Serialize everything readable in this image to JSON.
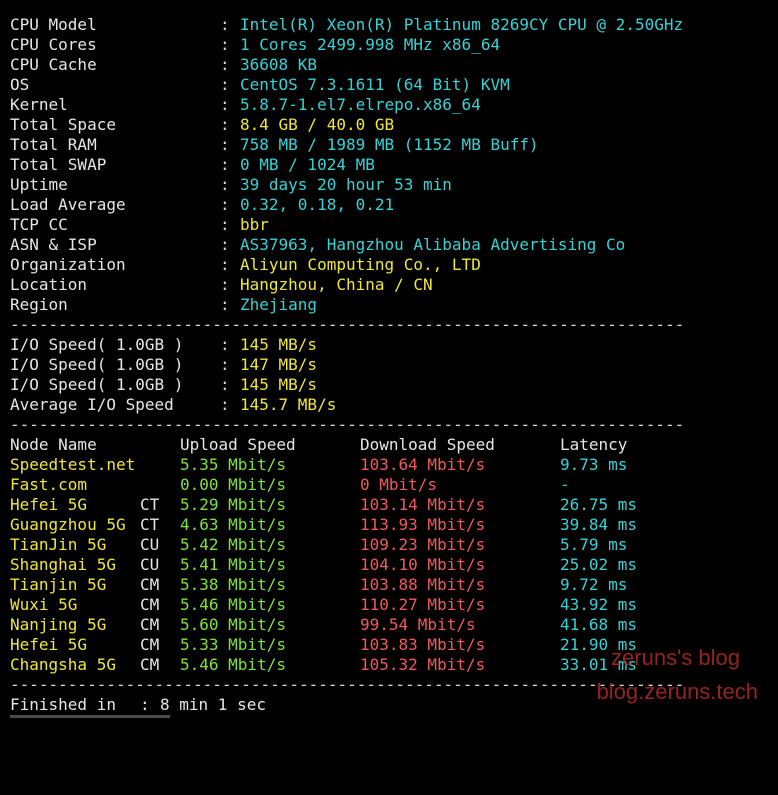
{
  "sysinfo": [
    {
      "label": "CPU Model",
      "value": "Intel(R) Xeon(R) Platinum 8269CY CPU @ 2.50GHz",
      "color": "cyan"
    },
    {
      "label": "CPU Cores",
      "value": "1 Cores 2499.998 MHz x86_64",
      "color": "cyan"
    },
    {
      "label": "CPU Cache",
      "value": "36608 KB",
      "color": "cyan"
    },
    {
      "label": "OS",
      "value": "CentOS 7.3.1611 (64 Bit) KVM",
      "color": "cyan"
    },
    {
      "label": "Kernel",
      "value": "5.8.7-1.el7.elrepo.x86_64",
      "color": "cyan"
    },
    {
      "label": "Total Space",
      "value": "8.4 GB / 40.0 GB",
      "color": "yellow"
    },
    {
      "label": "Total RAM",
      "value": "758 MB / 1989 MB (1152 MB Buff)",
      "color": "cyan"
    },
    {
      "label": "Total SWAP",
      "value": "0 MB / 1024 MB",
      "color": "cyan"
    },
    {
      "label": "Uptime",
      "value": "39 days 20 hour 53 min",
      "color": "cyan"
    },
    {
      "label": "Load Average",
      "value": "0.32, 0.18, 0.21",
      "color": "cyan"
    },
    {
      "label": "TCP CC",
      "value": "bbr",
      "color": "yellow"
    },
    {
      "label": "ASN & ISP",
      "value": "AS37963, Hangzhou Alibaba Advertising Co",
      "color": "cyan"
    },
    {
      "label": "Organization",
      "value": "Aliyun Computing Co., LTD",
      "color": "yellow"
    },
    {
      "label": "Location",
      "value": "Hangzhou, China / CN",
      "color": "yellow"
    },
    {
      "label": "Region",
      "value": "Zhejiang",
      "color": "cyan"
    }
  ],
  "separator": ":",
  "divider": "----------------------------------------------------------------------",
  "io": [
    {
      "label": "I/O Speed( 1.0GB )",
      "value": "145 MB/s"
    },
    {
      "label": "I/O Speed( 1.0GB )",
      "value": "147 MB/s"
    },
    {
      "label": "I/O Speed( 1.0GB )",
      "value": "145 MB/s"
    },
    {
      "label": "Average I/O Speed",
      "value": "145.7 MB/s"
    }
  ],
  "speed": {
    "headers": [
      "Node Name",
      "Upload Speed",
      "Download Speed",
      "Latency"
    ],
    "rows": [
      {
        "node": "Speedtest.net",
        "isp": "",
        "up": "5.35 Mbit/s",
        "down": "103.64 Mbit/s",
        "lat": "9.73 ms",
        "node_color": "yellow"
      },
      {
        "node": "Fast.com",
        "isp": "",
        "up": "0.00 Mbit/s",
        "down": "0 Mbit/s",
        "lat": "-",
        "node_color": "yellow"
      },
      {
        "node": "Hefei 5G",
        "isp": "CT",
        "up": "5.29 Mbit/s",
        "down": "103.14 Mbit/s",
        "lat": "26.75 ms",
        "node_color": "yellow"
      },
      {
        "node": "Guangzhou 5G",
        "isp": "CT",
        "up": "4.63 Mbit/s",
        "down": "113.93 Mbit/s",
        "lat": "39.84 ms",
        "node_color": "yellow"
      },
      {
        "node": "TianJin 5G",
        "isp": "CU",
        "up": "5.42 Mbit/s",
        "down": "109.23 Mbit/s",
        "lat": "5.79 ms",
        "node_color": "yellow"
      },
      {
        "node": "Shanghai 5G",
        "isp": "CU",
        "up": "5.41 Mbit/s",
        "down": "104.10 Mbit/s",
        "lat": "25.02 ms",
        "node_color": "yellow"
      },
      {
        "node": "Tianjin 5G",
        "isp": "CM",
        "up": "5.38 Mbit/s",
        "down": "103.88 Mbit/s",
        "lat": "9.72 ms",
        "node_color": "yellow"
      },
      {
        "node": "Wuxi 5G",
        "isp": "CM",
        "up": "5.46 Mbit/s",
        "down": "110.27 Mbit/s",
        "lat": "43.92 ms",
        "node_color": "yellow"
      },
      {
        "node": "Nanjing 5G",
        "isp": "CM",
        "up": "5.60 Mbit/s",
        "down": "99.54 Mbit/s",
        "lat": "41.68 ms",
        "node_color": "yellow"
      },
      {
        "node": "Hefei 5G",
        "isp": "CM",
        "up": "5.33 Mbit/s",
        "down": "103.83 Mbit/s",
        "lat": "21.90 ms",
        "node_color": "yellow"
      },
      {
        "node": "Changsha 5G",
        "isp": "CM",
        "up": "5.46 Mbit/s",
        "down": "105.32 Mbit/s",
        "lat": "33.01 ms",
        "node_color": "yellow"
      }
    ]
  },
  "finished": {
    "label": "Finished in",
    "value": "8 min 1 sec"
  },
  "watermark": {
    "line1": "zeruns's blog",
    "line2": "blog.zeruns.tech"
  },
  "colors": {
    "white": "#e6e6e6",
    "cyan": "#36d2d6",
    "yellow": "#efe640",
    "green": "#7ee33a",
    "red": "#ef5a5a",
    "isp": "#e1a030"
  }
}
